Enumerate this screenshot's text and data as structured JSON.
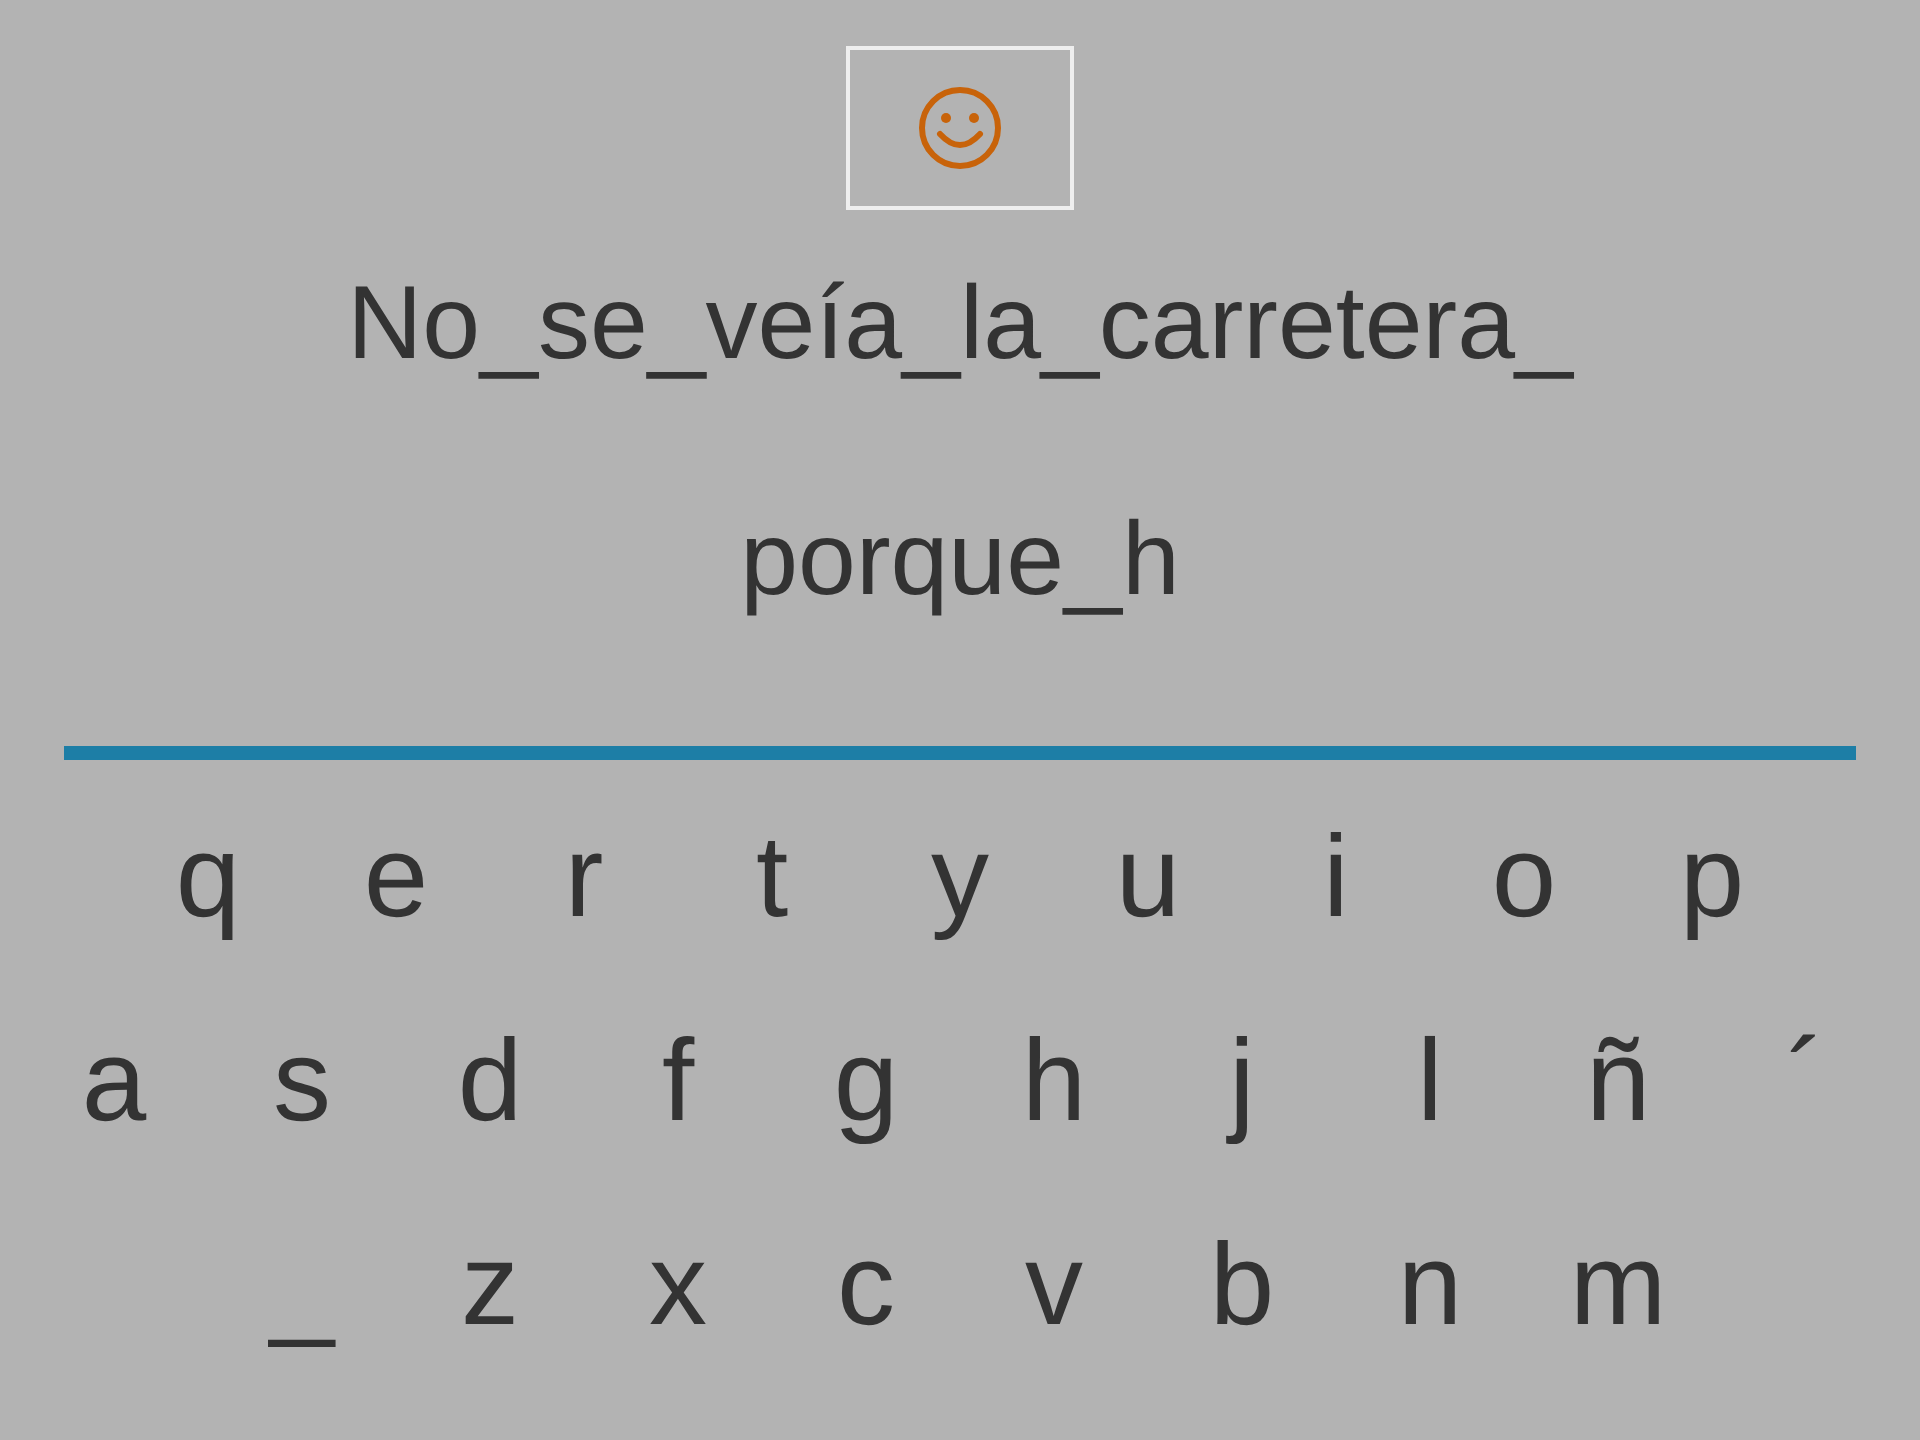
{
  "sentence_lines": [
    "No_se_veía_la_carretera_",
    "porque_h"
  ],
  "keyboard_rows": [
    [
      "q",
      "e",
      "r",
      "t",
      "y",
      "u",
      "i",
      "o",
      "p"
    ],
    [
      "a",
      "s",
      "d",
      "f",
      "g",
      "h",
      "j",
      "l",
      "ñ",
      "´"
    ],
    [
      "_",
      "z",
      "x",
      "c",
      "v",
      "b",
      "n",
      "m"
    ]
  ]
}
